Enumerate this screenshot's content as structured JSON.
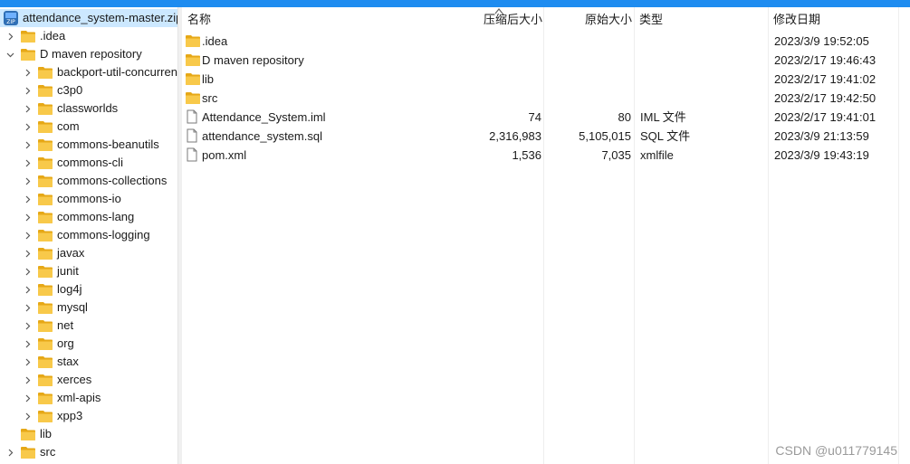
{
  "tree": {
    "root_label": "attendance_system-master.zip",
    "items": [
      {
        "label": ".idea",
        "level": 1,
        "expandable": true
      },
      {
        "label": "D      maven    repository",
        "level": 1,
        "expandable": true,
        "expanded": true
      },
      {
        "label": "backport-util-concurrent",
        "level": 2,
        "expandable": true
      },
      {
        "label": "c3p0",
        "level": 2,
        "expandable": true
      },
      {
        "label": "classworlds",
        "level": 2,
        "expandable": true
      },
      {
        "label": "com",
        "level": 2,
        "expandable": true
      },
      {
        "label": "commons-beanutils",
        "level": 2,
        "expandable": true
      },
      {
        "label": "commons-cli",
        "level": 2,
        "expandable": true
      },
      {
        "label": "commons-collections",
        "level": 2,
        "expandable": true
      },
      {
        "label": "commons-io",
        "level": 2,
        "expandable": true
      },
      {
        "label": "commons-lang",
        "level": 2,
        "expandable": true
      },
      {
        "label": "commons-logging",
        "level": 2,
        "expandable": true
      },
      {
        "label": "javax",
        "level": 2,
        "expandable": true
      },
      {
        "label": "junit",
        "level": 2,
        "expandable": true
      },
      {
        "label": "log4j",
        "level": 2,
        "expandable": true
      },
      {
        "label": "mysql",
        "level": 2,
        "expandable": true
      },
      {
        "label": "net",
        "level": 2,
        "expandable": true
      },
      {
        "label": "org",
        "level": 2,
        "expandable": true
      },
      {
        "label": "stax",
        "level": 2,
        "expandable": true
      },
      {
        "label": "xerces",
        "level": 2,
        "expandable": true
      },
      {
        "label": "xml-apis",
        "level": 2,
        "expandable": true
      },
      {
        "label": "xpp3",
        "level": 2,
        "expandable": true
      },
      {
        "label": "lib",
        "level": 1,
        "expandable": false
      },
      {
        "label": "src",
        "level": 1,
        "expandable": true
      }
    ]
  },
  "list": {
    "columns": {
      "name": "名称",
      "compressed": "压缩后大小",
      "original": "原始大小",
      "type": "类型",
      "modified": "修改日期"
    },
    "rows": [
      {
        "name": ".idea",
        "icon": "folder-icon",
        "compressed": "",
        "original": "",
        "type": "",
        "modified": "2023/3/9 19:52:05"
      },
      {
        "name": "D      maven    repository",
        "icon": "folder-icon",
        "compressed": "",
        "original": "",
        "type": "",
        "modified": "2023/2/17 19:46:43"
      },
      {
        "name": "lib",
        "icon": "folder-icon",
        "compressed": "",
        "original": "",
        "type": "",
        "modified": "2023/2/17 19:41:02"
      },
      {
        "name": "src",
        "icon": "folder-icon",
        "compressed": "",
        "original": "",
        "type": "",
        "modified": "2023/2/17 19:42:50"
      },
      {
        "name": "Attendance_System.iml",
        "icon": "file-icon",
        "compressed": "74",
        "original": "80",
        "type": "IML 文件",
        "modified": "2023/2/17 19:41:01"
      },
      {
        "name": "attendance_system.sql",
        "icon": "file-icon",
        "compressed": "2,316,983",
        "original": "5,105,015",
        "type": "SQL 文件",
        "modified": "2023/3/9 21:13:59"
      },
      {
        "name": "pom.xml",
        "icon": "file-icon",
        "compressed": "1,536",
        "original": "7,035",
        "type": "xmlfile",
        "modified": "2023/3/9 19:43:19"
      }
    ]
  },
  "watermark": "CSDN @u011779145",
  "colors": {
    "accent": "#1e8cf0",
    "selection": "#cce8ff",
    "folder": "#f8c94a",
    "folder_dark": "#e6a817"
  }
}
